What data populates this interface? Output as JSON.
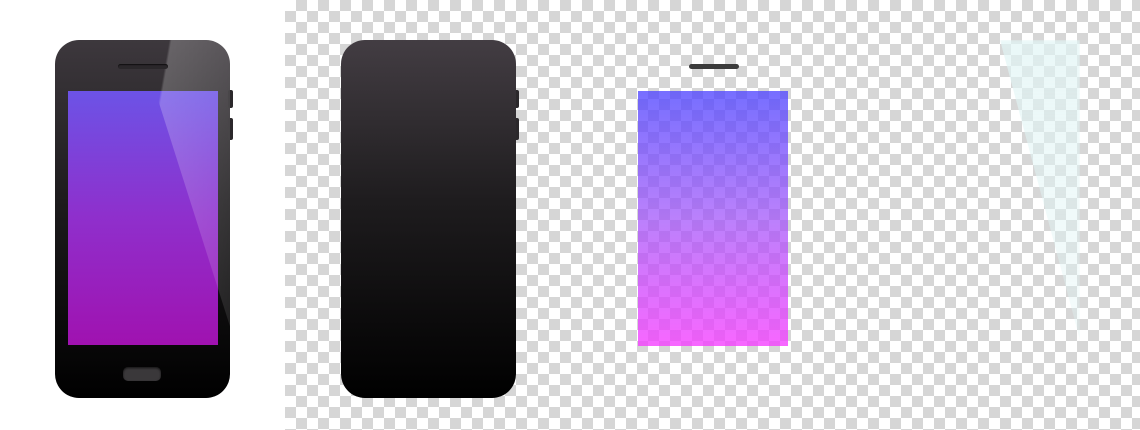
{
  "colors": {
    "canvas_background": "#ffffff",
    "checker_light": "#ffffff",
    "checker_dark": "#d6d6d6",
    "body_top": "#433d43",
    "body_bottom": "#000000",
    "screen_top": "#6c53e6",
    "screen_bottom": "#a012b0",
    "glare": "#e1f5f5"
  },
  "icons": {
    "composite": "smartphone-icon",
    "body": "phone-body-shape",
    "screen": "phone-screen-shape",
    "glare": "glass-glare-shape"
  }
}
